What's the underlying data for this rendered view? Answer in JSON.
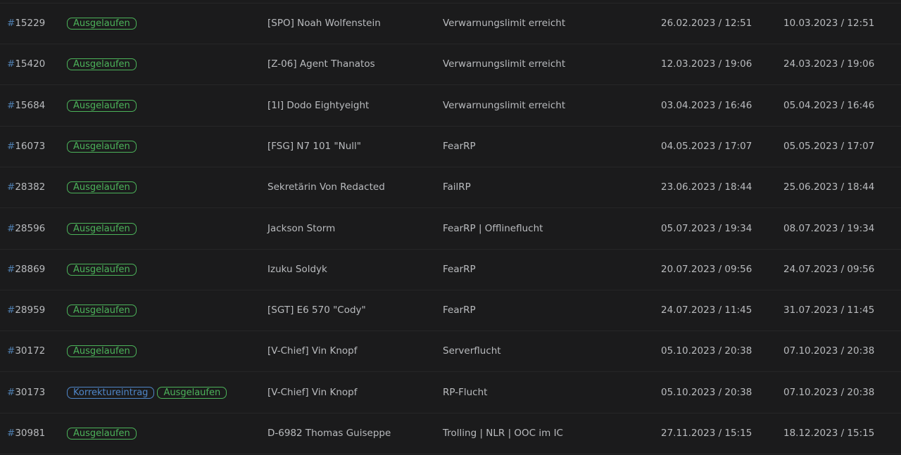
{
  "rows": [
    {
      "hash": "#",
      "id": "15229",
      "badges": [
        {
          "label": "Ausgelaufen",
          "kind": "green"
        }
      ],
      "name": "[SPO] Noah Wolfenstein",
      "reason": "Verwarnungslimit erreicht",
      "start": "26.02.2023 / 12:51",
      "end": "10.03.2023 / 12:51"
    },
    {
      "hash": "#",
      "id": "15420",
      "badges": [
        {
          "label": "Ausgelaufen",
          "kind": "green"
        }
      ],
      "name": "[Z-06] Agent Thanatos",
      "reason": "Verwarnungslimit erreicht",
      "start": "12.03.2023 / 19:06",
      "end": "24.03.2023 / 19:06"
    },
    {
      "hash": "#",
      "id": "15684",
      "badges": [
        {
          "label": "Ausgelaufen",
          "kind": "green"
        }
      ],
      "name": "[1I] Dodo Eightyeight",
      "reason": "Verwarnungslimit erreicht",
      "start": "03.04.2023 / 16:46",
      "end": "05.04.2023 / 16:46"
    },
    {
      "hash": "#",
      "id": "16073",
      "badges": [
        {
          "label": "Ausgelaufen",
          "kind": "green"
        }
      ],
      "name": "[FSG] N7 101 \"Null\"",
      "reason": "FearRP",
      "start": "04.05.2023 / 17:07",
      "end": "05.05.2023 / 17:07"
    },
    {
      "hash": "#",
      "id": "28382",
      "badges": [
        {
          "label": "Ausgelaufen",
          "kind": "green"
        }
      ],
      "name": "Sekretärin Von Redacted",
      "reason": "FailRP",
      "start": "23.06.2023 / 18:44",
      "end": "25.06.2023 / 18:44"
    },
    {
      "hash": "#",
      "id": "28596",
      "badges": [
        {
          "label": "Ausgelaufen",
          "kind": "green"
        }
      ],
      "name": "Jackson Storm",
      "reason": "FearRP | Offlineflucht",
      "start": "05.07.2023 / 19:34",
      "end": "08.07.2023 / 19:34"
    },
    {
      "hash": "#",
      "id": "28869",
      "badges": [
        {
          "label": "Ausgelaufen",
          "kind": "green"
        }
      ],
      "name": "Izuku Soldyk",
      "reason": "FearRP",
      "start": "20.07.2023 / 09:56",
      "end": "24.07.2023 / 09:56"
    },
    {
      "hash": "#",
      "id": "28959",
      "badges": [
        {
          "label": "Ausgelaufen",
          "kind": "green"
        }
      ],
      "name": "[SGT] E6 570 \"Cody\"",
      "reason": "FearRP",
      "start": "24.07.2023 / 11:45",
      "end": "31.07.2023 / 11:45"
    },
    {
      "hash": "#",
      "id": "30172",
      "badges": [
        {
          "label": "Ausgelaufen",
          "kind": "green"
        }
      ],
      "name": "[V-Chief] Vin Knopf",
      "reason": "Serverflucht",
      "start": "05.10.2023 / 20:38",
      "end": "07.10.2023 / 20:38"
    },
    {
      "hash": "#",
      "id": "30173",
      "badges": [
        {
          "label": "Korrektureintrag",
          "kind": "blue"
        },
        {
          "label": "Ausgelaufen",
          "kind": "green"
        }
      ],
      "name": "[V-Chief] Vin Knopf",
      "reason": "RP-Flucht",
      "start": "05.10.2023 / 20:38",
      "end": "07.10.2023 / 20:38"
    },
    {
      "hash": "#",
      "id": "30981",
      "badges": [
        {
          "label": "Ausgelaufen",
          "kind": "green"
        }
      ],
      "name": "D-6982 Thomas Guiseppe",
      "reason": "Trolling | NLR | OOC im IC",
      "start": "27.11.2023 / 15:15",
      "end": "18.12.2023 / 15:15"
    }
  ],
  "colors": {
    "background": "#1b1b1c",
    "text": "#b9bbbe",
    "hash": "#4f7fb0",
    "badge_green": "#4cb35a",
    "badge_blue": "#4f86c8",
    "divider": "#262627"
  }
}
